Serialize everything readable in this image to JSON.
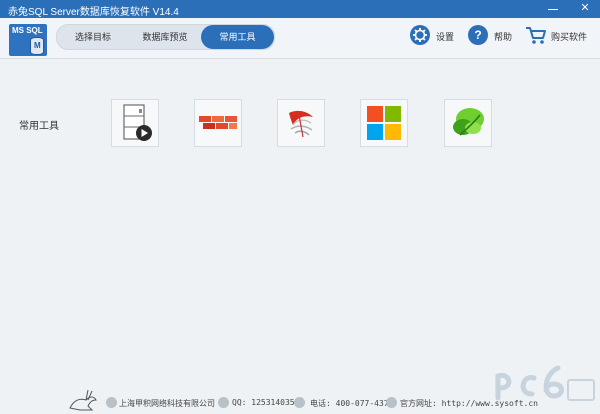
{
  "window": {
    "title": "赤兔SQL Server数据库恢复软件 V14.4",
    "minimize": "—",
    "close": "✕"
  },
  "logo": {
    "line1": "MS SQL",
    "mark": "M"
  },
  "tabs": [
    {
      "label": "选择目标",
      "active": false
    },
    {
      "label": "数据库预览",
      "active": false
    },
    {
      "label": "常用工具",
      "active": true
    }
  ],
  "header_buttons": {
    "settings": {
      "label": "设置",
      "icon": "gear-icon"
    },
    "help": {
      "label": "帮助",
      "icon": "question-icon"
    },
    "buy": {
      "label": "购买软件",
      "icon": "cart-icon"
    }
  },
  "main": {
    "section_label": "常用工具",
    "tools": [
      {
        "icon": "server-play-icon"
      },
      {
        "icon": "red-blocks-icon"
      },
      {
        "icon": "sql-server-icon"
      },
      {
        "icon": "windows-logo-icon"
      },
      {
        "icon": "green-leaf-icon"
      }
    ]
  },
  "footer": {
    "company": "上海甲积网络科技有限公司",
    "qq": "QQ: 1253140355",
    "phone": "电话: 400-077-4377",
    "website": "官方网址: http://www.sysoft.cn"
  },
  "colors": {
    "titlebar": "#2a6fb8",
    "accent": "#2c6fb9",
    "background": "#eef2f5"
  }
}
